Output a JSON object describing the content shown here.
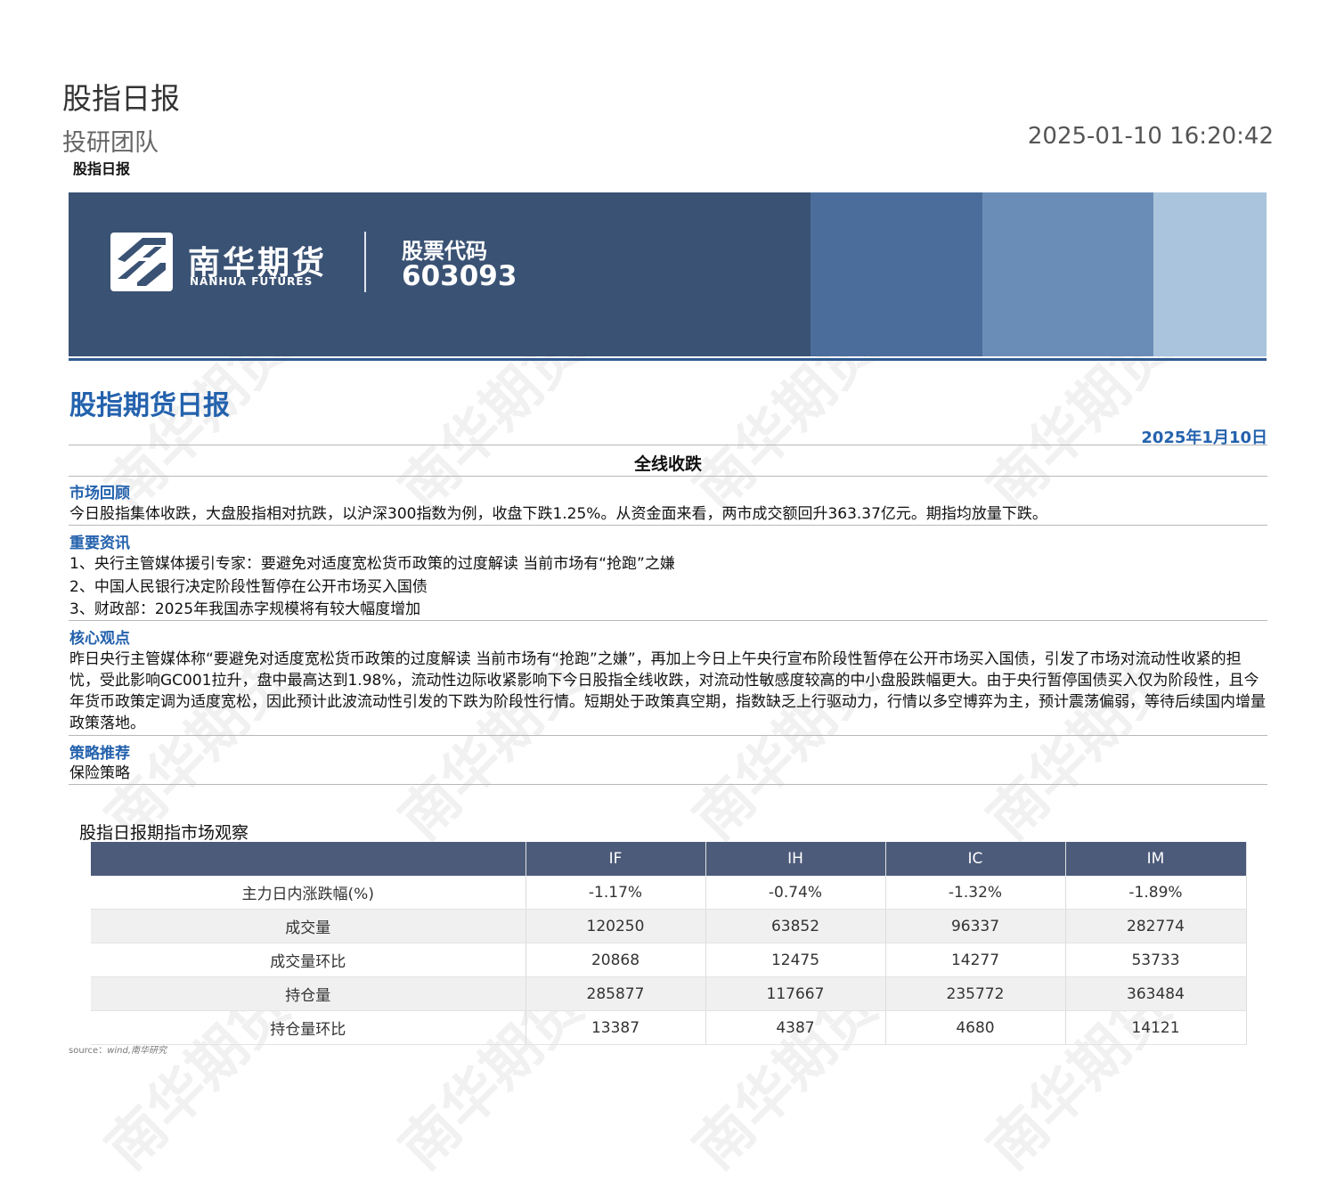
{
  "header": {
    "doc_title": "股指日报",
    "team": "投研团队",
    "timestamp": "2025-01-10 16:20:42",
    "small_title": "股指日报"
  },
  "banner": {
    "logo_cn": "南华期货",
    "logo_en": "NANHUA FUTURES",
    "code_label": "股票代码",
    "code_value": "603093",
    "colors": [
      "#3a5274",
      "#4a6d9c",
      "#6a8db8",
      "#a9c4dc"
    ]
  },
  "report": {
    "title": "股指期货日报",
    "date": "2025年1月10日",
    "headline": "全线收跌"
  },
  "sections": {
    "market_review": {
      "title": "市场回顾",
      "text": "今日股指集体收跌，大盘股指相对抗跌，以沪深300指数为例，收盘下跌1.25%。从资金面来看，两市成交额回升363.37亿元。期指均放量下跌。"
    },
    "news": {
      "title": "重要资讯",
      "items": [
        "1、央行主管媒体援引专家：要避免对适度宽松货币政策的过度解读 当前市场有“抢跑”之嫌",
        "2、中国人民银行决定阶段性暂停在公开市场买入国债",
        "3、财政部：2025年我国赤字规模将有较大幅度增加"
      ]
    },
    "core_view": {
      "title": "核心观点",
      "text": "昨日央行主管媒体称“要避免对适度宽松货币政策的过度解读 当前市场有“抢跑”之嫌”，再加上今日上午央行宣布阶段性暂停在公开市场买入国债，引发了市场对流动性收紧的担忧，受此影响GC001拉升，盘中最高达到1.98%，流动性边际收紧影响下今日股指全线收跌，对流动性敏感度较高的中小盘股跌幅更大。由于央行暂停国债买入仅为阶段性，且今年货币政策定调为适度宽松，因此预计此波流动性引发的下跌为阶段性行情。短期处于政策真空期，指数缺乏上行驱动力，行情以多空博弈为主，预计震荡偏弱，等待后续国内增量政策落地。"
    },
    "strategy": {
      "title": "策略推荐",
      "text": "保险策略"
    }
  },
  "table": {
    "caption": "股指日报期指市场观察",
    "columns": [
      "",
      "IF",
      "IH",
      "IC",
      "IM"
    ],
    "rows": [
      [
        "主力日内涨跌幅(%)",
        "-1.17%",
        "-0.74%",
        "-1.32%",
        "-1.89%"
      ],
      [
        "成交量",
        "120250",
        "63852",
        "96337",
        "282774"
      ],
      [
        "成交量环比",
        "20868",
        "12475",
        "14277",
        "53733"
      ],
      [
        "持仓量",
        "285877",
        "117667",
        "235772",
        "363484"
      ],
      [
        "持仓量环比",
        "13387",
        "4387",
        "4680",
        "14121"
      ]
    ],
    "header_color": "#4c5b7a"
  },
  "source": {
    "label": "source：",
    "value": "wind,南华研究"
  },
  "watermark": "南华期货",
  "accent_color": "#2462ad"
}
